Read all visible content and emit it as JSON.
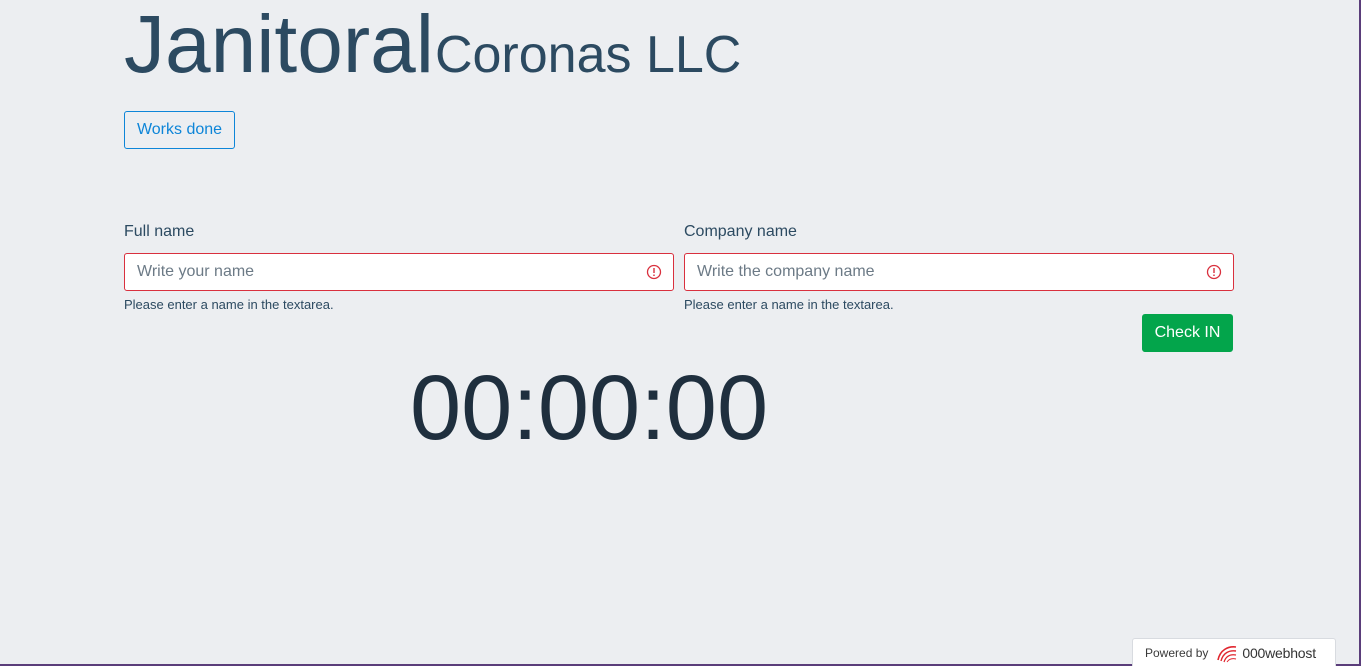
{
  "header": {
    "title_main": "Janitoral",
    "title_sub": "Coronas LLC"
  },
  "nav": {
    "works_done_label": "Works done"
  },
  "form": {
    "full_name": {
      "label": "Full name",
      "placeholder": "Write your name",
      "value": "",
      "error": "Please enter a name in the textarea."
    },
    "company_name": {
      "label": "Company name",
      "placeholder": "Write the company name",
      "value": "",
      "error": "Please enter a name in the textarea."
    },
    "check_in_label": "Check IN"
  },
  "timer": {
    "display": "00:00:00"
  },
  "footer": {
    "powered_by": "Powered by",
    "brand": "000webhost"
  },
  "colors": {
    "background": "#eceef1",
    "title": "#2c4a61",
    "primary_outline": "#0d85d8",
    "error": "#d9303e",
    "success": "#03a54b",
    "timer": "#1f2f3e"
  },
  "icons": {
    "field_error": "exclamation-circle-icon",
    "brand_logo": "000webhost-logo-icon"
  }
}
